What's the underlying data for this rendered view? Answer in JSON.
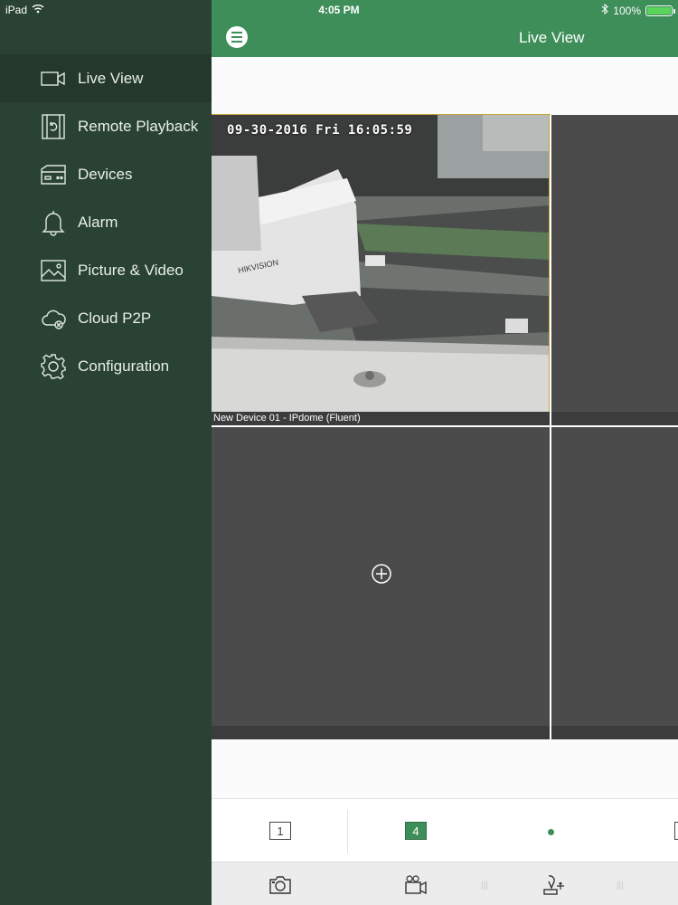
{
  "status_bar": {
    "device": "iPad",
    "time": "4:05 PM",
    "battery": "100%",
    "battery_level": 1.0
  },
  "sidebar": {
    "items": [
      {
        "label": "Live View",
        "icon": "video-camera-icon",
        "active": true
      },
      {
        "label": "Remote Playback",
        "icon": "playback-film-icon",
        "active": false
      },
      {
        "label": "Devices",
        "icon": "dvr-device-icon",
        "active": false
      },
      {
        "label": "Alarm",
        "icon": "bell-icon",
        "active": false
      },
      {
        "label": "Picture & Video",
        "icon": "picture-icon",
        "active": false
      },
      {
        "label": "Cloud P2P",
        "icon": "cloud-icon",
        "active": false
      },
      {
        "label": "Configuration",
        "icon": "gear-icon",
        "active": false
      }
    ]
  },
  "header": {
    "title": "Live View",
    "menu_icon": "menu-icon"
  },
  "live_grid": {
    "layout": "2x2",
    "cells": [
      {
        "caption": "New Device 01 - IPdome (Fluent)",
        "timestamp": "09-30-2016 Fri 16:05:59",
        "has_video": true,
        "selected": true
      },
      {
        "caption": "",
        "has_video": false,
        "selected": false
      },
      {
        "caption": "",
        "has_video": false,
        "selected": false,
        "add_icon": "add-camera-icon"
      },
      {
        "caption": "",
        "has_video": false,
        "selected": false
      }
    ]
  },
  "layout_bar": {
    "single_label": "1",
    "quad_label": "4",
    "accent_color": "#3e8e5a"
  },
  "toolbar": {
    "icons": [
      "camera-snapshot-icon",
      "record-video-icon",
      "ptz-control-icon"
    ]
  },
  "colors": {
    "sidebar_bg": "#2a4233",
    "header_green": "#3e8e5a",
    "selected_outline": "#c9a43a"
  }
}
